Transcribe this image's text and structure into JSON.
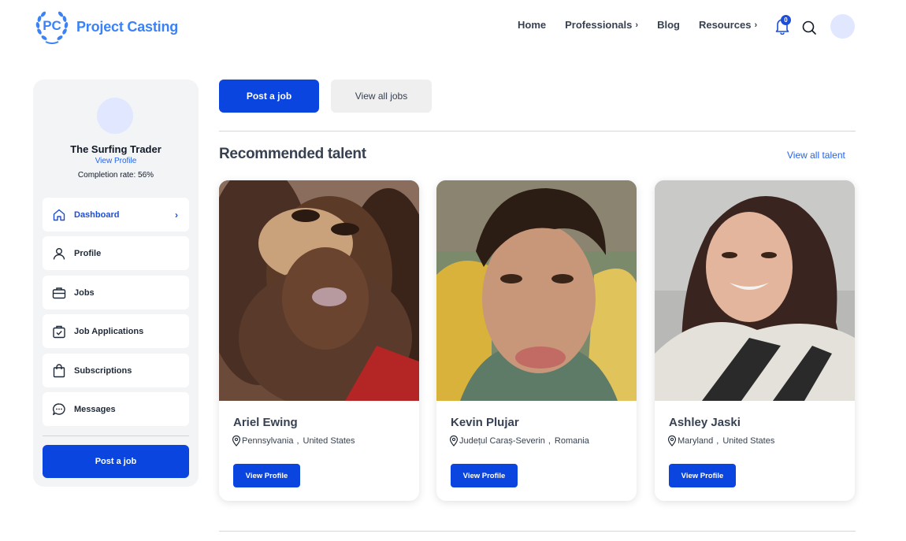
{
  "header": {
    "logo_initials": "PC",
    "logo_text": "Project Casting",
    "nav": [
      {
        "label": "Home",
        "has_chevron": false
      },
      {
        "label": "Professionals",
        "has_chevron": true
      },
      {
        "label": "Blog",
        "has_chevron": false
      },
      {
        "label": "Resources",
        "has_chevron": true
      }
    ],
    "notification_count": "0",
    "icons": [
      "bell-icon",
      "search-icon"
    ]
  },
  "sidebar": {
    "user_name": "The Surfing Trader",
    "view_profile": "View Profile",
    "completion": "Completion rate: 56%",
    "items": [
      {
        "label": "Dashboard",
        "icon": "home-icon",
        "active": true
      },
      {
        "label": "Profile",
        "icon": "user-icon",
        "active": false
      },
      {
        "label": "Jobs",
        "icon": "briefcase-icon",
        "active": false
      },
      {
        "label": "Job Applications",
        "icon": "clipboard-check-icon",
        "active": false
      },
      {
        "label": "Subscriptions",
        "icon": "shopping-bag-icon",
        "active": false
      },
      {
        "label": "Messages",
        "icon": "chat-icon",
        "active": false
      }
    ],
    "post_job": "Post a job"
  },
  "main": {
    "post_job": "Post a job",
    "view_all_jobs": "View all jobs",
    "section_title": "Recommended talent",
    "view_all_talent": "View all talent",
    "talent": [
      {
        "name": "Ariel Ewing",
        "region": "Pennsylvania",
        "country": "United States",
        "button": "View Profile"
      },
      {
        "name": "Kevin Plujar",
        "region": "Județul Caraș-Severin",
        "country": "Romania",
        "button": "View Profile"
      },
      {
        "name": "Ashley Jaski",
        "region": "Maryland",
        "country": "United States",
        "button": "View Profile"
      }
    ]
  },
  "colors": {
    "primary": "#0a45e0",
    "link": "#2563eb",
    "sidebar_bg": "#f3f4f6",
    "avatar_bg": "#e0e7ff"
  }
}
